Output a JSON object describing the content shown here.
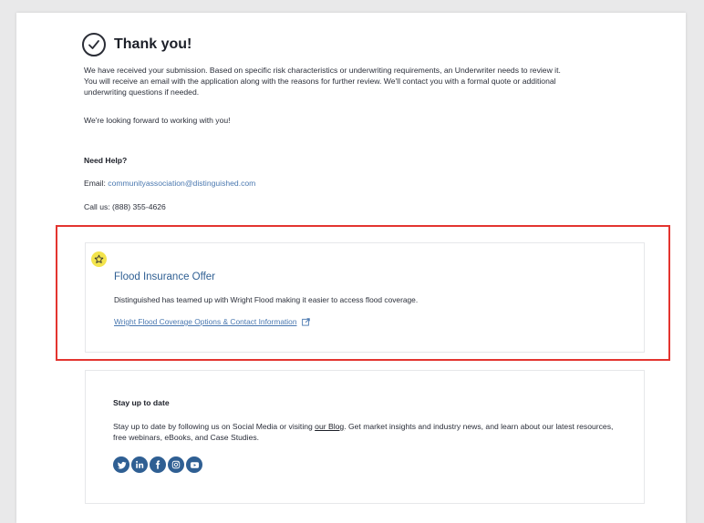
{
  "confirmation": {
    "title": "Thank you!",
    "message": "We have received your submission.  Based on specific risk characteristics or underwriting requirements, an Underwriter needs to review it.  You will receive an email with the application along with the reasons for further review.    We'll contact you with a formal quote or additional underwriting questions if needed.",
    "looking_forward": "We're looking forward to working with you!"
  },
  "help": {
    "title": "Need Help?",
    "email_label": "Email:",
    "email": "communityassociation@distinguished.com",
    "call_label": "Call us:",
    "phone": "(888) 355-4626"
  },
  "offer": {
    "icon": "star-icon",
    "title": "Flood Insurance Offer",
    "description": "Distinguished has teamed up with Wright Flood making it easier to access flood coverage.",
    "link_text": "Wright Flood Coverage Options & Contact Information",
    "badge_color": "#f3e44c",
    "highlight_color": "#e3342f"
  },
  "stay": {
    "title": "Stay up to date",
    "text_before": "Stay up to date by following us on Social Media or visiting ",
    "blog_link": "our Blog",
    "text_after": ". Get market insights and industry news, and learn about our latest resources, free webinars, eBooks, and Case Studies.",
    "social": [
      "twitter-icon",
      "linkedin-icon",
      "facebook-icon",
      "instagram-icon",
      "youtube-icon"
    ],
    "social_color": "#2f5f93"
  }
}
